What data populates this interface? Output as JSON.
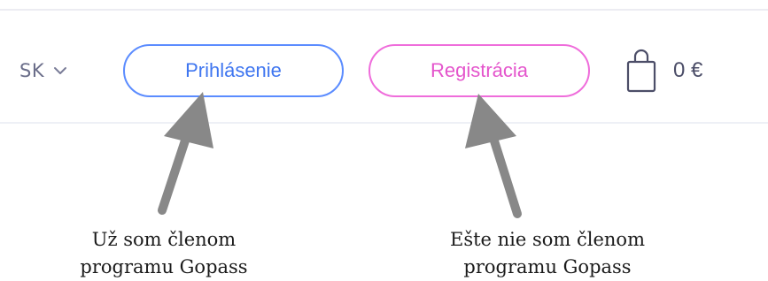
{
  "header": {
    "language": {
      "code": "SK",
      "icon": "chevron-down-icon"
    },
    "login_button": {
      "label": "Prihlásenie",
      "color": "#3f76f0"
    },
    "register_button": {
      "label": "Registrácia",
      "color": "#e455cc"
    },
    "cart": {
      "icon": "shopping-bag-icon",
      "amount": "0 €"
    }
  },
  "annotations": {
    "login_caption": {
      "line1": "Už som členom",
      "line2": "programu Gopass"
    },
    "register_caption": {
      "line1": "Ešte nie som členom",
      "line2": "programu Gopass"
    },
    "arrow_color": "#888888"
  }
}
